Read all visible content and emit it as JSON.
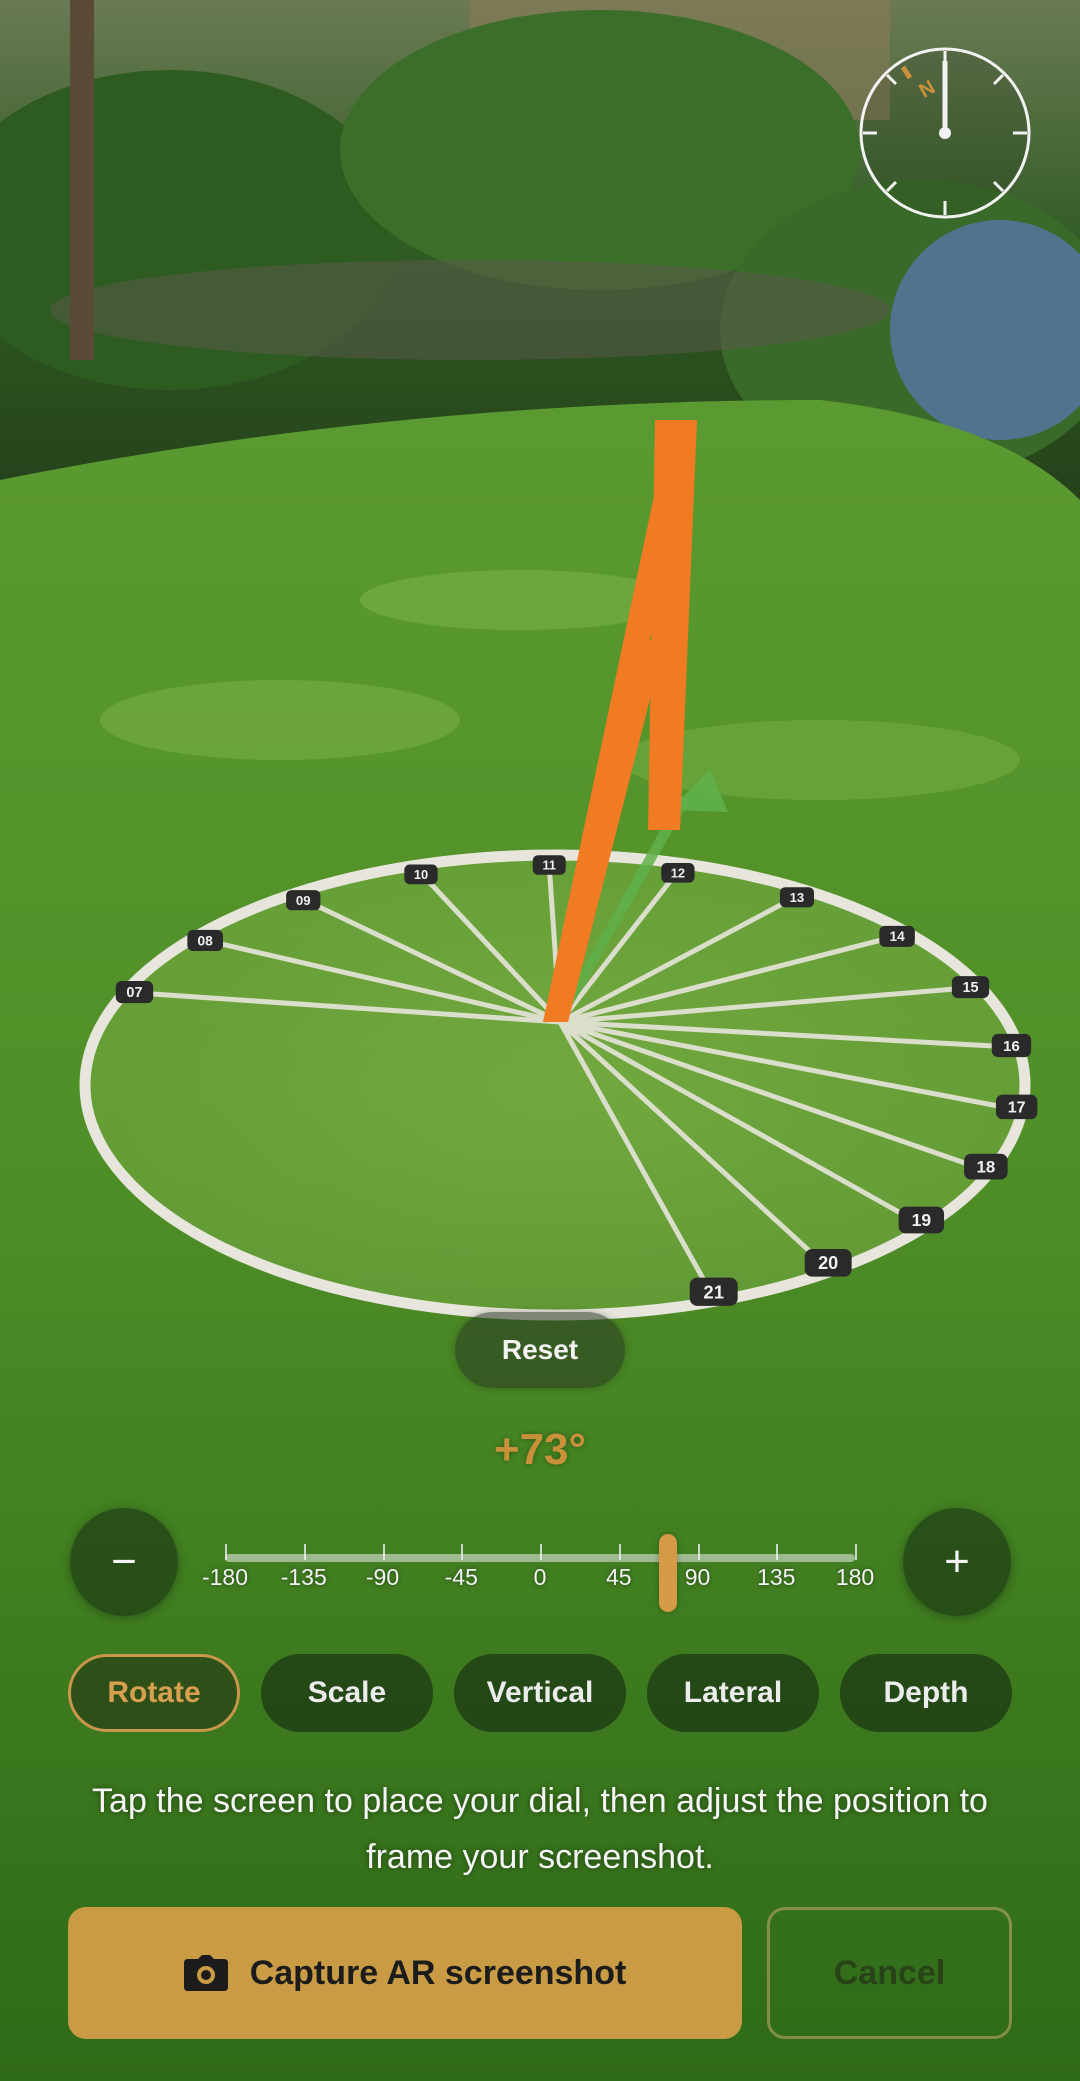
{
  "compass": {
    "direction_label": "N"
  },
  "dial": {
    "hour_labels": [
      "07",
      "08",
      "09",
      "10",
      "11",
      "12",
      "13",
      "14",
      "15",
      "16",
      "17",
      "18",
      "19",
      "20",
      "21"
    ]
  },
  "reset_label": "Reset",
  "rotation": {
    "angle_text": "+73°",
    "value_deg": 73,
    "min": -180,
    "max": 180,
    "tick_labels": [
      "-180",
      "-135",
      "-90",
      "-45",
      "0",
      "45",
      "90",
      "135",
      "180"
    ],
    "minus_label": "−",
    "plus_label": "+"
  },
  "tabs": [
    {
      "label": "Rotate",
      "active": true
    },
    {
      "label": "Scale",
      "active": false
    },
    {
      "label": "Vertical",
      "active": false
    },
    {
      "label": "Lateral",
      "active": false
    },
    {
      "label": "Depth",
      "active": false
    }
  ],
  "instruction": "Tap the screen to place your dial, then adjust the position to frame your screenshot.",
  "capture_label": "Capture AR screenshot",
  "cancel_label": "Cancel",
  "colors": {
    "accent": "#c99b45",
    "gnomon": "#f07b23",
    "sun_arrow": "#5fb04a",
    "dial_ring": "#e8e6dc"
  },
  "icons": {
    "capture": "camera-icon",
    "compass": "compass-icon"
  }
}
